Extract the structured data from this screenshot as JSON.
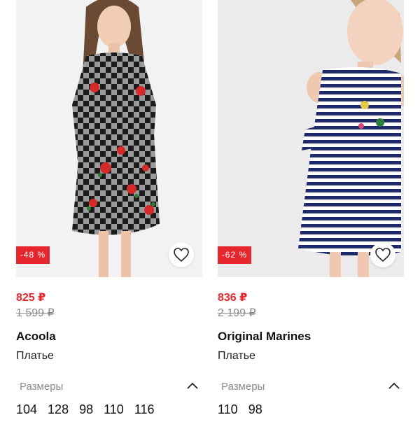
{
  "products": [
    {
      "discount": "-48 %",
      "price": "825 ₽",
      "old_price": "1 599 ₽",
      "brand": "Acoola",
      "type": "Платье",
      "sizes_label": "Размеры",
      "sizes": [
        "104",
        "128",
        "98",
        "110",
        "116"
      ],
      "photo_icon": "girl-in-checkered-floral-dress-photo",
      "favorite_icon": "heart-outline-icon",
      "chevron_icon": "chevron-up-icon"
    },
    {
      "discount": "-62 %",
      "price": "836 ₽",
      "old_price": "2 199 ₽",
      "brand": "Original Marines",
      "type": "Платье",
      "sizes_label": "Размеры",
      "sizes": [
        "110",
        "98"
      ],
      "photo_icon": "girl-in-striped-dress-photo",
      "favorite_icon": "heart-outline-icon",
      "chevron_icon": "chevron-up-icon"
    }
  ],
  "colors": {
    "accent_red": "#e5262c",
    "muted_text": "#8a8a8a",
    "text": "#111111"
  }
}
